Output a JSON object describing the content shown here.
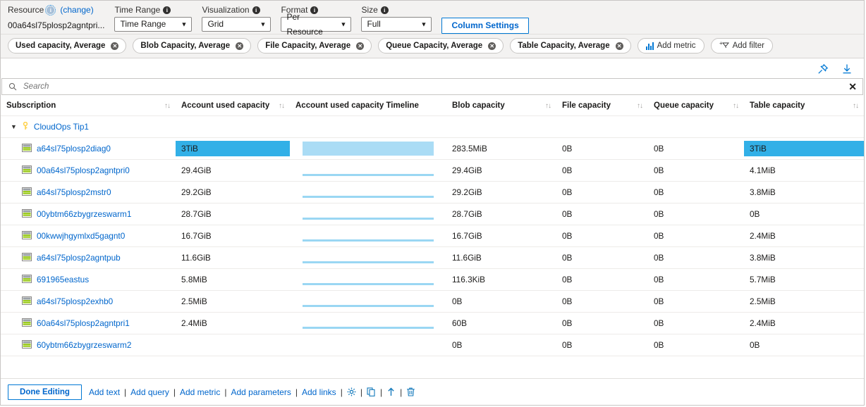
{
  "params": {
    "resource": {
      "label": "Resource",
      "change_link": "(change)",
      "value": "00a64sl75plosp2agntpri..."
    },
    "time_range": {
      "label": "Time Range",
      "value": "Time Range"
    },
    "visualization": {
      "label": "Visualization",
      "value": "Grid"
    },
    "format": {
      "label": "Format",
      "value": "Per Resource"
    },
    "size": {
      "label": "Size",
      "value": "Full"
    },
    "column_settings_label": "Column Settings"
  },
  "chips": [
    {
      "label": "Used capacity, Average",
      "removable": true
    },
    {
      "label": "Blob Capacity, Average",
      "removable": true
    },
    {
      "label": "File Capacity, Average",
      "removable": true
    },
    {
      "label": "Queue Capacity, Average",
      "removable": true
    },
    {
      "label": "Table Capacity, Average",
      "removable": true
    },
    {
      "label": "Add metric",
      "removable": false,
      "icon": "add-metric-icon"
    },
    {
      "label": "Add filter",
      "removable": false,
      "icon": "add-filter-icon"
    }
  ],
  "actions": [
    {
      "name": "pin-icon"
    },
    {
      "name": "download-icon"
    }
  ],
  "search": {
    "placeholder": "Search",
    "value": "",
    "clear_label": "✕"
  },
  "table": {
    "columns": [
      {
        "key": "subscription",
        "label": "Subscription",
        "sortable": true
      },
      {
        "key": "account_used",
        "label": "Account used capacity",
        "sortable": true
      },
      {
        "key": "timeline",
        "label": "Account used capacity Timeline",
        "sortable": false
      },
      {
        "key": "blob",
        "label": "Blob capacity",
        "sortable": true
      },
      {
        "key": "file",
        "label": "File capacity",
        "sortable": true
      },
      {
        "key": "queue",
        "label": "Queue capacity",
        "sortable": true
      },
      {
        "key": "table",
        "label": "Table capacity",
        "sortable": true
      }
    ],
    "group": {
      "name": "CloudOps Tip1",
      "expanded": true,
      "icon": "key-icon"
    },
    "rows": [
      {
        "name": "a64sl75plosp2diag0",
        "account_used": "3TiB",
        "used_highlight": true,
        "timeline_pct": 100,
        "timeline_type": "bar",
        "blob": "283.5MiB",
        "file": "0B",
        "queue": "0B",
        "table": "3TiB",
        "table_highlight": true
      },
      {
        "name": "00a64sl75plosp2agntpri0",
        "account_used": "29.4GiB",
        "used_highlight": false,
        "timeline_pct": 100,
        "timeline_type": "spark",
        "blob": "29.4GiB",
        "file": "0B",
        "queue": "0B",
        "table": "4.1MiB",
        "table_highlight": false
      },
      {
        "name": "a64sl75plosp2mstr0",
        "account_used": "29.2GiB",
        "used_highlight": false,
        "timeline_pct": 100,
        "timeline_type": "spark",
        "blob": "29.2GiB",
        "file": "0B",
        "queue": "0B",
        "table": "3.8MiB",
        "table_highlight": false
      },
      {
        "name": "00ybtm66zbygrzeswarm1",
        "account_used": "28.7GiB",
        "used_highlight": false,
        "timeline_pct": 100,
        "timeline_type": "spark",
        "blob": "28.7GiB",
        "file": "0B",
        "queue": "0B",
        "table": "0B",
        "table_highlight": false
      },
      {
        "name": "00kwwjhgymlxd5gagnt0",
        "account_used": "16.7GiB",
        "used_highlight": false,
        "timeline_pct": 100,
        "timeline_type": "spark",
        "blob": "16.7GiB",
        "file": "0B",
        "queue": "0B",
        "table": "2.4MiB",
        "table_highlight": false
      },
      {
        "name": "a64sl75plosp2agntpub",
        "account_used": "11.6GiB",
        "used_highlight": false,
        "timeline_pct": 100,
        "timeline_type": "spark",
        "blob": "11.6GiB",
        "file": "0B",
        "queue": "0B",
        "table": "3.8MiB",
        "table_highlight": false
      },
      {
        "name": "691965eastus",
        "account_used": "5.8MiB",
        "used_highlight": false,
        "timeline_pct": 100,
        "timeline_type": "spark",
        "blob": "116.3KiB",
        "file": "0B",
        "queue": "0B",
        "table": "5.7MiB",
        "table_highlight": false
      },
      {
        "name": "a64sl75plosp2exhb0",
        "account_used": "2.5MiB",
        "used_highlight": false,
        "timeline_pct": 100,
        "timeline_type": "spark",
        "blob": "0B",
        "file": "0B",
        "queue": "0B",
        "table": "2.5MiB",
        "table_highlight": false
      },
      {
        "name": "60a64sl75plosp2agntpri1",
        "account_used": "2.4MiB",
        "used_highlight": false,
        "timeline_pct": 100,
        "timeline_type": "spark",
        "blob": "60B",
        "file": "0B",
        "queue": "0B",
        "table": "2.4MiB",
        "table_highlight": false
      },
      {
        "name": "60ybtm66zbygrzeswarm2",
        "account_used": "",
        "used_highlight": false,
        "timeline_pct": 0,
        "timeline_type": "none",
        "blob": "0B",
        "file": "0B",
        "queue": "0B",
        "table": "0B",
        "table_highlight": false
      }
    ]
  },
  "footer": {
    "done_label": "Done Editing",
    "links": [
      "Add text",
      "Add query",
      "Add metric",
      "Add parameters",
      "Add links"
    ],
    "separator": "|",
    "icons": [
      {
        "name": "settings-gear-icon"
      },
      {
        "name": "copy-icon"
      },
      {
        "name": "move-up-icon"
      },
      {
        "name": "delete-trash-icon"
      }
    ]
  },
  "colors": {
    "accent": "#0078d4",
    "link": "#0066cc",
    "highlight": "#32b0e7",
    "bar": "#aadcf5",
    "key": "#ffd24d"
  }
}
